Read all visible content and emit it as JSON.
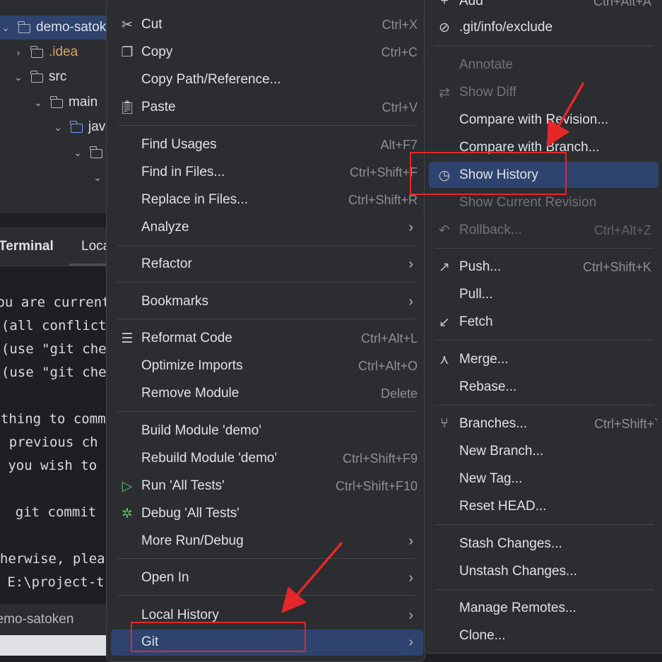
{
  "project_tree": {
    "rows": [
      {
        "label": "demo-satoken",
        "indent": 0
      },
      {
        "label": ".idea",
        "indent": 1
      },
      {
        "label": "src",
        "indent": 1
      },
      {
        "label": "main",
        "indent": 2
      },
      {
        "label": "java",
        "indent": 3
      }
    ]
  },
  "terminal": {
    "tabs": [
      "Terminal",
      "Local"
    ],
    "lines": [
      "You are currently",
      "  (all conflicts",
      "  (use \"git che",
      "  (use \"git che",
      "",
      "nothing to comm",
      "The previous ch",
      "If you wish to",
      "",
      "    git commit",
      "",
      "Otherwise, plea",
      "PS E:\\project-t"
    ],
    "status": "demo-satoken"
  },
  "context_menu": {
    "items": [
      {
        "label": "Cut",
        "shortcut": "Ctrl+X",
        "icon": "scissors-icon"
      },
      {
        "label": "Copy",
        "shortcut": "Ctrl+C",
        "icon": "copy-icon"
      },
      {
        "label": "Copy Path/Reference...",
        "shortcut": ""
      },
      {
        "label": "Paste",
        "shortcut": "Ctrl+V",
        "icon": "paste-icon"
      },
      {
        "label": "Find Usages",
        "shortcut": "Alt+F7"
      },
      {
        "label": "Find in Files...",
        "shortcut": "Ctrl+Shift+F"
      },
      {
        "label": "Replace in Files...",
        "shortcut": "Ctrl+Shift+R"
      },
      {
        "label": "Analyze",
        "submenu": true
      },
      {
        "label": "Refactor",
        "submenu": true
      },
      {
        "label": "Bookmarks",
        "submenu": true
      },
      {
        "label": "Reformat Code",
        "shortcut": "Ctrl+Alt+L",
        "icon": "reformat-icon"
      },
      {
        "label": "Optimize Imports",
        "shortcut": "Ctrl+Alt+O"
      },
      {
        "label": "Remove Module",
        "shortcut": "Delete"
      },
      {
        "label": "Build Module 'demo'",
        "shortcut": ""
      },
      {
        "label": "Rebuild Module 'demo'",
        "shortcut": "Ctrl+Shift+F9"
      },
      {
        "label": "Run 'All Tests'",
        "shortcut": "Ctrl+Shift+F10",
        "icon": "run-icon"
      },
      {
        "label": "Debug 'All Tests'",
        "shortcut": "",
        "icon": "debug-icon"
      },
      {
        "label": "More Run/Debug",
        "submenu": true
      },
      {
        "label": "Open In",
        "submenu": true
      },
      {
        "label": "Local History",
        "submenu": true
      },
      {
        "label": "Git",
        "submenu": true,
        "selected": true
      }
    ]
  },
  "git_menu": {
    "items": [
      {
        "label": "Add",
        "shortcut": "Ctrl+Alt+A",
        "icon": "plus-icon"
      },
      {
        "label": ".git/info/exclude",
        "icon": "ignore-icon"
      },
      {
        "label": "Annotate",
        "disabled": true
      },
      {
        "label": "Show Diff",
        "disabled": true,
        "icon": "diff-icon"
      },
      {
        "label": "Compare with Revision..."
      },
      {
        "label": "Compare with Branch..."
      },
      {
        "label": "Show History",
        "icon": "history-icon",
        "selected": true
      },
      {
        "label": "Show Current Revision",
        "disabled": true
      },
      {
        "label": "Rollback...",
        "shortcut": "Ctrl+Alt+Z",
        "disabled": true,
        "icon": "rollback-icon"
      },
      {
        "label": "Push...",
        "shortcut": "Ctrl+Shift+K",
        "icon": "push-icon"
      },
      {
        "label": "Pull..."
      },
      {
        "label": "Fetch",
        "icon": "fetch-icon"
      },
      {
        "label": "Merge...",
        "icon": "merge-icon"
      },
      {
        "label": "Rebase..."
      },
      {
        "label": "Branches...",
        "shortcut": "Ctrl+Shift+`",
        "icon": "branch-icon"
      },
      {
        "label": "New Branch..."
      },
      {
        "label": "New Tag..."
      },
      {
        "label": "Reset HEAD..."
      },
      {
        "label": "Stash Changes..."
      },
      {
        "label": "Unstash Changes..."
      },
      {
        "label": "Manage Remotes..."
      },
      {
        "label": "Clone..."
      }
    ]
  },
  "colors": {
    "annotation_red": "#e5272a",
    "selection_blue": "#2e436e"
  }
}
